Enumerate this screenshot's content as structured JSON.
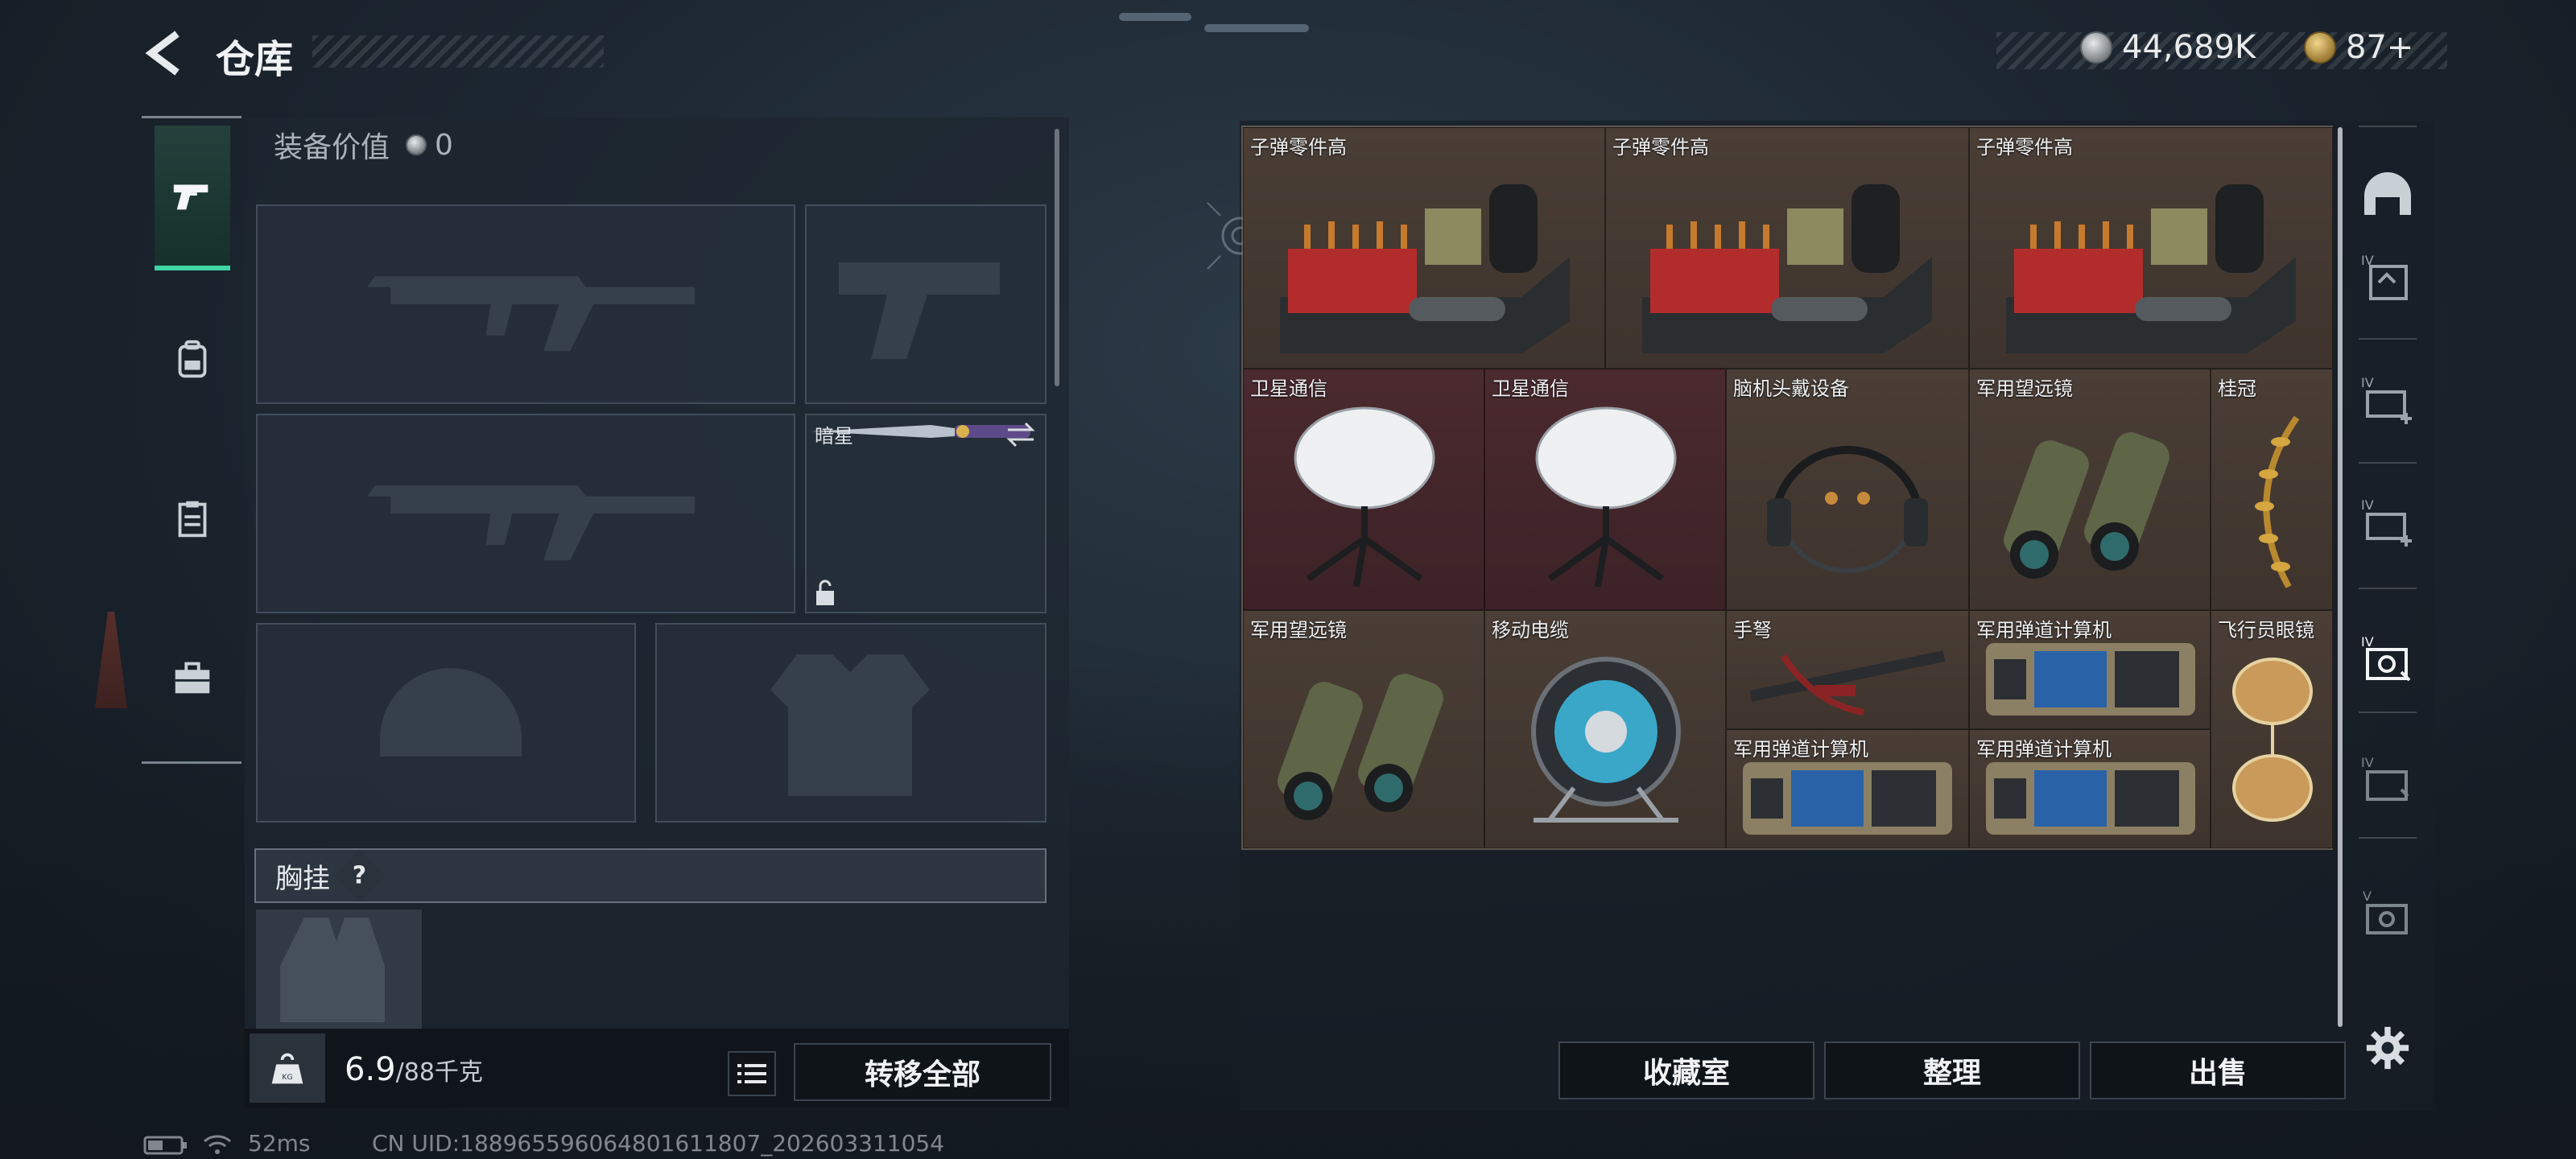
{
  "header": {
    "title": "仓库",
    "currency_silver": "44,689K",
    "currency_gold": "87+"
  },
  "left_rail": {
    "tabs": [
      {
        "icon": "pistol-icon",
        "active": true
      },
      {
        "icon": "backpack-icon",
        "active": false
      },
      {
        "icon": "clipboard-icon",
        "active": false
      },
      {
        "icon": "toolbox-icon",
        "active": false
      }
    ]
  },
  "equipment": {
    "value_label": "装备价值",
    "value": "0",
    "melee_slot_label": "暗星",
    "chest_rig_label": "胸挂",
    "chest_rig_help": "?"
  },
  "footer_left": {
    "weight_current": "6.9",
    "weight_max": "/88千克",
    "transfer_all_label": "转移全部"
  },
  "stash": {
    "items": [
      {
        "label": "子弹零件高",
        "kind": "ammo-crate"
      },
      {
        "label": "子弹零件高",
        "kind": "ammo-crate"
      },
      {
        "label": "子弹零件高",
        "kind": "ammo-crate"
      },
      {
        "label": "卫星通信",
        "kind": "satellite-dish"
      },
      {
        "label": "卫星通信",
        "kind": "satellite-dish"
      },
      {
        "label": "脑机头戴设备",
        "kind": "headset"
      },
      {
        "label": "军用望远镜",
        "kind": "binoculars"
      },
      {
        "label": "桂冠",
        "kind": "laurel"
      },
      {
        "label": "军用望远镜",
        "kind": "binoculars"
      },
      {
        "label": "移动电缆",
        "kind": "cable-reel"
      },
      {
        "label": "手弩",
        "kind": "crossbow"
      },
      {
        "label": "军用弹道计算机",
        "kind": "ballistic-computer"
      },
      {
        "label": "飞行员眼镜",
        "kind": "aviator-glasses"
      },
      {
        "label": "军用弹道计算机",
        "kind": "ballistic-computer"
      },
      {
        "label": "军用弹道计算机",
        "kind": "ballistic-computer"
      }
    ]
  },
  "footer_right": {
    "collection_label": "收藏室",
    "sort_label": "整理",
    "sell_label": "出售"
  },
  "right_rail": {
    "tabs": [
      {
        "icon": "helmet-tab-icon",
        "tier": ""
      },
      {
        "icon": "case-tier-iv-icon",
        "tier": "IV"
      },
      {
        "icon": "case-tier-iv-plus-icon",
        "tier": "IV"
      },
      {
        "icon": "case-tier-iv-plus-icon",
        "tier": "IV"
      },
      {
        "icon": "case-tier-iv-active-icon",
        "tier": "IV"
      },
      {
        "icon": "case-tier-iv-icon",
        "tier": "IV"
      },
      {
        "icon": "case-tier-v-icon",
        "tier": "V"
      }
    ]
  },
  "status_bar": {
    "ping": "52ms",
    "uid": "CN UID:18896559606480161180​7_202603311054"
  },
  "colors": {
    "accent_green": "#3fd5a4",
    "cell_brown": "#4a3e36",
    "cell_red": "#4a2a2e"
  }
}
